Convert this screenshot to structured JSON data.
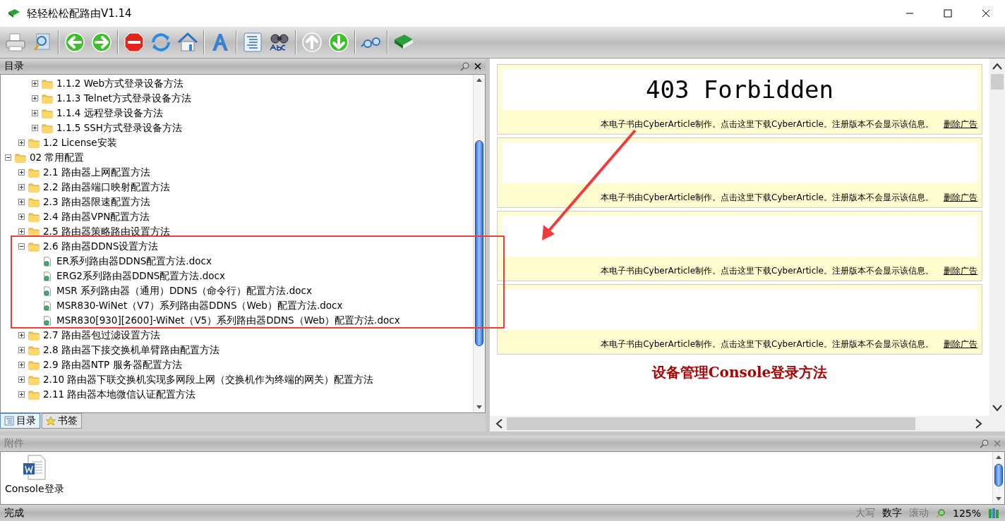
{
  "window": {
    "title": "轻轻松松配路由V1.14"
  },
  "toc_panel": {
    "title": "目录"
  },
  "tree": [
    {
      "children": [
        {
          "children": [
            {
              "label": "1.1.2 Web方式登录设备方法",
              "kind": "folder",
              "expanded": false
            },
            {
              "label": "1.1.3 Telnet方式登录设备方法",
              "kind": "folder",
              "expanded": false
            },
            {
              "label": "1.1.4 远程登录设备方法",
              "kind": "folder",
              "expanded": false
            },
            {
              "label": "1.1.5 SSH方式登录设备方法",
              "kind": "folder",
              "expanded": false
            }
          ]
        },
        {
          "label": "1.2 License安装",
          "kind": "folder",
          "expanded": false
        }
      ]
    },
    {
      "label": "02 常用配置",
      "kind": "folder",
      "expanded": true,
      "children": [
        {
          "label": "2.1 路由器上网配置方法",
          "kind": "folder",
          "expanded": false
        },
        {
          "label": "2.2 路由器端口映射配置方法",
          "kind": "folder",
          "expanded": false
        },
        {
          "label": "2.3 路由器限速配置方法",
          "kind": "folder",
          "expanded": false
        },
        {
          "label": "2.4 路由器VPN配置方法",
          "kind": "folder",
          "expanded": false
        },
        {
          "label": "2.5 路由器策略路由设置方法",
          "kind": "folder",
          "expanded": false
        },
        {
          "label": "2.6 路由器DDNS设置方法",
          "kind": "folder",
          "expanded": true,
          "children": [
            {
              "label": "ER系列路由器DDNS配置方法.docx",
              "kind": "doc"
            },
            {
              "label": "ERG2系列路由器DDNS配置方法.docx",
              "kind": "doc"
            },
            {
              "label": "MSR 系列路由器（通用）DDNS（命令行）配置方法.docx",
              "kind": "doc"
            },
            {
              "label": "MSR830-WiNet（V7）系列路由器DDNS（Web）配置方法.docx",
              "kind": "doc"
            },
            {
              "label": "MSR830[930][2600]-WiNet（V5）系列路由器DDNS（Web）配置方法.docx",
              "kind": "doc"
            }
          ]
        },
        {
          "label": "2.7 路由器包过滤设置方法",
          "kind": "folder",
          "expanded": false
        },
        {
          "label": "2.8 路由器下接交换机单臂路由配置方法",
          "kind": "folder",
          "expanded": false
        },
        {
          "label": "2.9 路由器NTP 服务器配置方法",
          "kind": "folder",
          "expanded": false
        },
        {
          "label": "2.10 路由器下联交换机实现多网段上网（交换机作为终端的网关）配置方法",
          "kind": "folder",
          "expanded": false
        },
        {
          "label": "2.11 路由器本地微信认证配置方法",
          "kind": "folder",
          "expanded": false
        }
      ]
    }
  ],
  "panel_tabs": [
    {
      "label": "目录",
      "selected": true
    },
    {
      "label": "书签",
      "selected": false
    }
  ],
  "content": {
    "blocks": [
      {
        "heading": "403 Forbidden",
        "notice": "本电子书由CyberArticle制作。点击这里下载CyberArticle。注册版本不会显示该信息。",
        "link": "删除广告"
      },
      {
        "notice": "本电子书由CyberArticle制作。点击这里下载CyberArticle。注册版本不会显示该信息。",
        "link": "删除广告"
      },
      {
        "notice": "本电子书由CyberArticle制作。点击这里下载CyberArticle。注册版本不会显示该信息。",
        "link": "删除广告"
      },
      {
        "notice": "本电子书由CyberArticle制作。点击这里下载CyberArticle。注册版本不会显示该信息。",
        "link": "删除广告"
      }
    ],
    "section_heading": "设备管理Console登录方法"
  },
  "attachments": {
    "title": "附件",
    "files": [
      {
        "name": "Console登录"
      }
    ]
  },
  "status_bar": {
    "text": "完成",
    "indicators": [
      {
        "label": "大写",
        "on": false
      },
      {
        "label": "数字",
        "on": true
      },
      {
        "label": "滚动",
        "on": false
      }
    ],
    "zoom": "125%"
  }
}
